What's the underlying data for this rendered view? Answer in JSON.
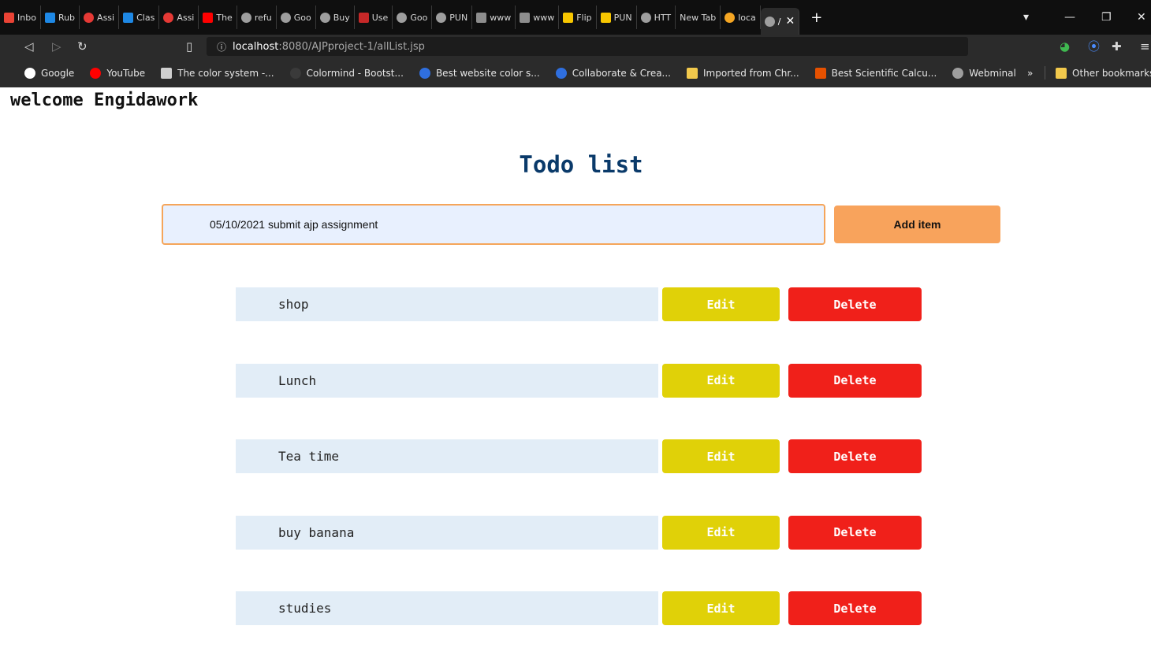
{
  "browser": {
    "tabs": [
      {
        "label": "Inbo",
        "icon": "gmail-icon",
        "color": "#ea4335"
      },
      {
        "label": "Rub",
        "icon": "classroom-icon",
        "color": "#1e88e5"
      },
      {
        "label": "Assi",
        "icon": "ring-icon",
        "color": "#e53935"
      },
      {
        "label": "Clas",
        "icon": "classroom-icon",
        "color": "#1e88e5"
      },
      {
        "label": "Assi",
        "icon": "ring-icon",
        "color": "#e53935"
      },
      {
        "label": "The",
        "icon": "youtube-icon",
        "color": "#ff0000"
      },
      {
        "label": "refu",
        "icon": "globe-icon",
        "color": "#9e9e9e"
      },
      {
        "label": "Goo",
        "icon": "globe-icon",
        "color": "#9e9e9e"
      },
      {
        "label": "Buy",
        "icon": "globe-icon",
        "color": "#9e9e9e"
      },
      {
        "label": "Use",
        "icon": "bh-icon",
        "color": "#c62828"
      },
      {
        "label": "Goo",
        "icon": "globe-icon",
        "color": "#9e9e9e"
      },
      {
        "label": "PUN",
        "icon": "globe-icon",
        "color": "#9e9e9e"
      },
      {
        "label": "www",
        "icon": "mail-icon",
        "color": "#8d8d8d"
      },
      {
        "label": "www",
        "icon": "mail-icon",
        "color": "#8d8d8d"
      },
      {
        "label": "Flip",
        "icon": "flipkart-icon",
        "color": "#f7c600"
      },
      {
        "label": "PUN",
        "icon": "flipkart-icon",
        "color": "#f7c600"
      },
      {
        "label": "HTT",
        "icon": "globe-icon",
        "color": "#9e9e9e"
      },
      {
        "label": "New Tab",
        "icon": "",
        "color": ""
      },
      {
        "label": "loca",
        "icon": "brave-icon",
        "color": "#f5a623"
      },
      {
        "label": "/",
        "icon": "globe-icon",
        "color": "#9e9e9e",
        "active": true
      }
    ],
    "url_host": "localhost",
    "url_path": ":8080/AJPproject-1/allList.jsp",
    "bookmarks": [
      {
        "label": "Google",
        "icon": "google-icon",
        "color": "#ffffff"
      },
      {
        "label": "YouTube",
        "icon": "youtube-icon",
        "color": "#ff0000"
      },
      {
        "label": "The color system -...",
        "icon": "bookmark-page-icon",
        "color": "#cfcfcf"
      },
      {
        "label": "Colormind - Bootst...",
        "icon": "colormind-icon",
        "color": "#3a3a3a"
      },
      {
        "label": "Best website color s...",
        "icon": "c-icon",
        "color": "#2f6fdf"
      },
      {
        "label": "Collaborate & Crea...",
        "icon": "c-icon",
        "color": "#2f6fdf"
      },
      {
        "label": "Imported from Chr...",
        "icon": "folder-icon",
        "color": "#f2c94c"
      },
      {
        "label": "Best Scientific Calcu...",
        "icon": "calculator-icon",
        "color": "#e65100"
      },
      {
        "label": "Webminal",
        "icon": "globe-icon",
        "color": "#9e9e9e"
      }
    ],
    "more_bookmarks": "»",
    "other_bookmarks": "Other bookmarks"
  },
  "page": {
    "welcome": "welcome Engidawork",
    "title": "Todo list",
    "new_item_value": "05/10/2021 submit ajp assignment",
    "add_label": "Add item",
    "edit_label": "Edit",
    "delete_label": "Delete",
    "items": [
      "shop",
      "Lunch",
      "Tea time",
      "buy banana",
      "studies"
    ]
  }
}
